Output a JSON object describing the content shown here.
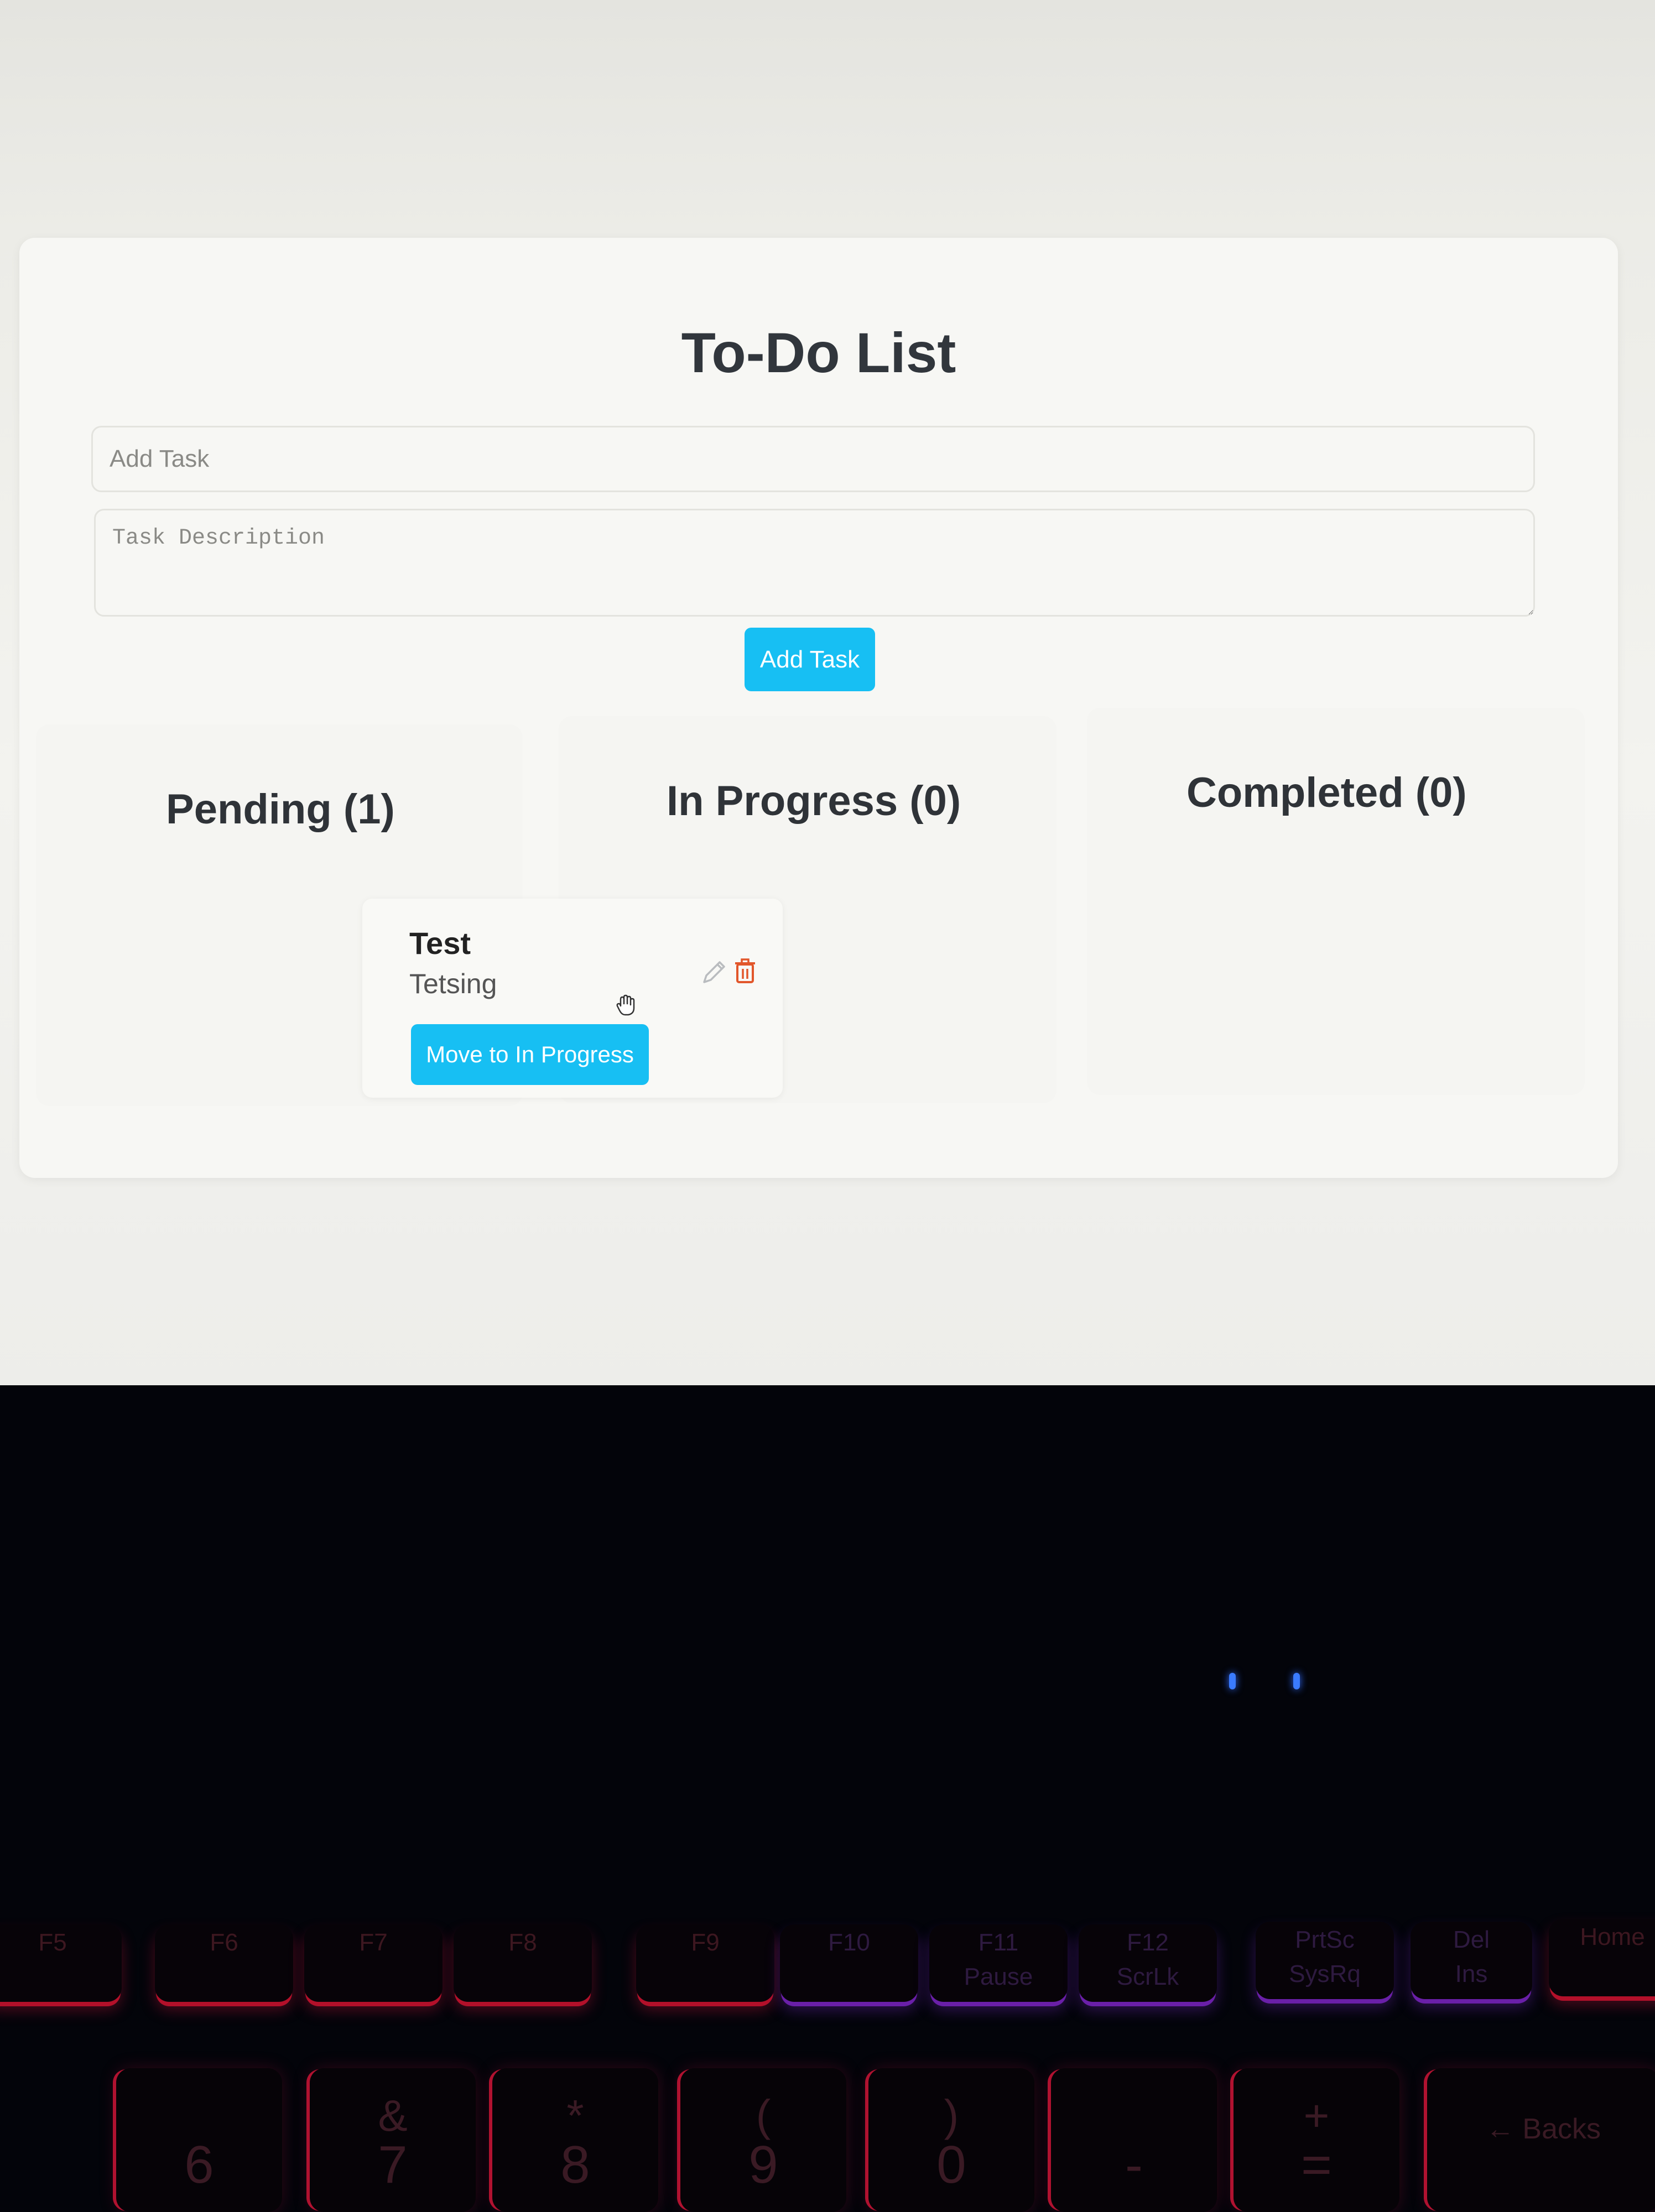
{
  "app": {
    "title": "To-Do List",
    "accent_color": "#17bff3",
    "delete_color": "#e2572b"
  },
  "form": {
    "task_placeholder": "Add Task",
    "description_placeholder": "Task Description",
    "add_button": "Add Task"
  },
  "columns": [
    {
      "label": "Pending (1)"
    },
    {
      "label": "In Progress (0)"
    },
    {
      "label": "Completed (0)"
    }
  ],
  "tasks": [
    {
      "title": "Test",
      "description": "Tetsing",
      "action_label": "Move to In Progress",
      "icons": [
        "pencil-icon",
        "trash-icon"
      ]
    }
  ],
  "keyboard": {
    "fn_row": [
      {
        "top": "F5",
        "bottom": ""
      },
      {
        "top": "F6",
        "bottom": ""
      },
      {
        "top": "F7",
        "bottom": ""
      },
      {
        "top": "F8",
        "bottom": ""
      },
      {
        "top": "F9",
        "bottom": ""
      },
      {
        "top": "F10",
        "bottom": ""
      },
      {
        "top": "F11",
        "bottom": "Pause"
      },
      {
        "top": "F12",
        "bottom": "ScrLk"
      },
      {
        "top": "PrtSc",
        "bottom": "SysRq"
      },
      {
        "top": "Del",
        "bottom": "Ins"
      },
      {
        "top": "Home",
        "bottom": ""
      }
    ],
    "number_row": [
      {
        "top": "",
        "bottom": "6"
      },
      {
        "top": "&",
        "bottom": "7"
      },
      {
        "top": "*",
        "bottom": "8"
      },
      {
        "top": "(",
        "bottom": "9"
      },
      {
        "top": ")",
        "bottom": "0"
      },
      {
        "top": "",
        "bottom": "-"
      },
      {
        "top": "+",
        "bottom": "="
      },
      {
        "top": "",
        "bottom": "← Backs"
      }
    ]
  }
}
